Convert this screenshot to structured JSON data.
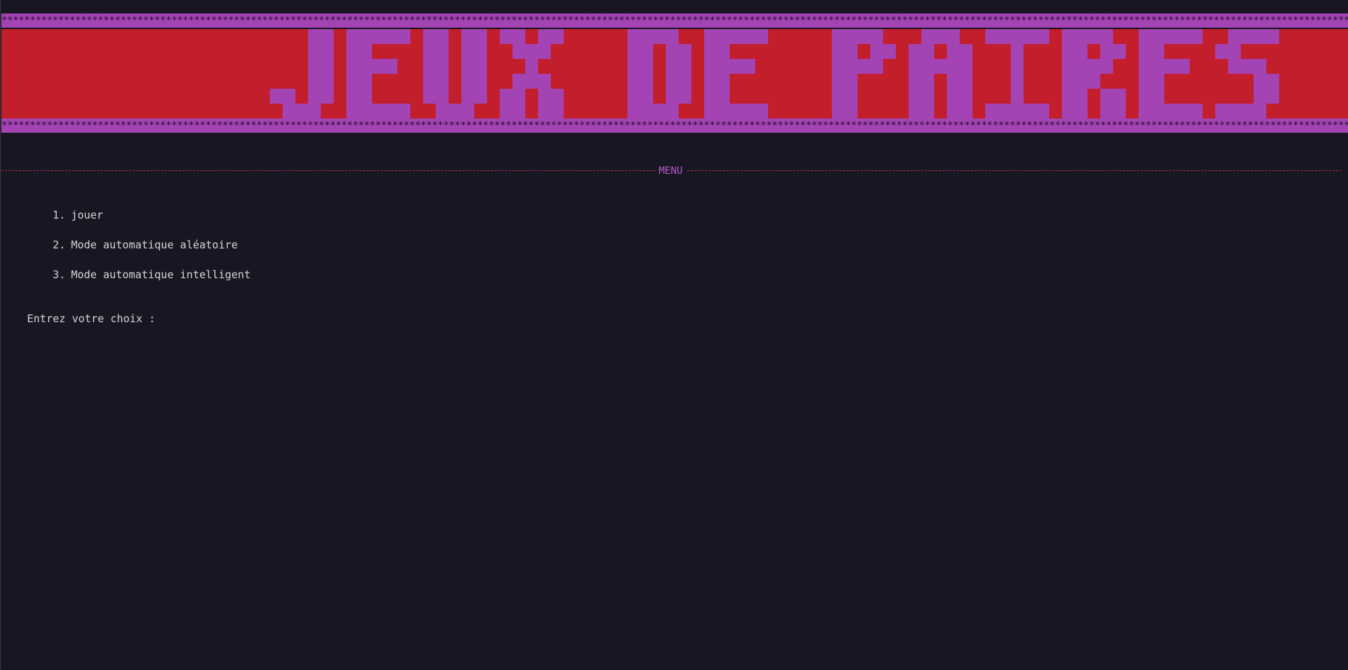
{
  "colors": {
    "background": "#171622",
    "banner_red": "#c21e2c",
    "banner_purple": "#a444b4",
    "text": "#d6d6d6",
    "menu_accent": "#b45ec8",
    "rule": "#a9344d"
  },
  "banner": {
    "border_fill": "*",
    "logo_text": "JEUX DE PAIRES"
  },
  "menu": {
    "title": "MENU",
    "items": [
      {
        "number": "1.",
        "label": "jouer"
      },
      {
        "number": "2.",
        "label": "Mode automatique aléatoire"
      },
      {
        "number": "3.",
        "label": "Mode automatique intelligent"
      }
    ]
  },
  "prompt": {
    "text": "Entrez votre choix :"
  }
}
